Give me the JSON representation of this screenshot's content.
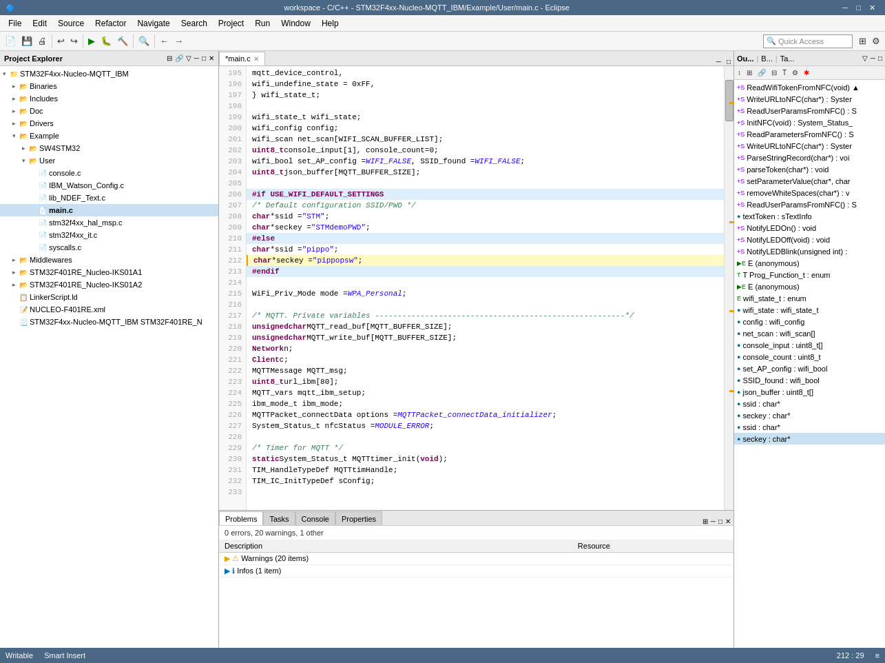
{
  "titleBar": {
    "title": "workspace - C/C++ - STM32F4xx-Nucleo-MQTT_IBM/Example/User/main.c - Eclipse",
    "icon": "🔷",
    "minimize": "─",
    "maximize": "□",
    "close": "✕"
  },
  "menuBar": {
    "items": [
      "File",
      "Edit",
      "Source",
      "Refactor",
      "Navigate",
      "Search",
      "Project",
      "Run",
      "Window",
      "Help"
    ]
  },
  "quickAccess": {
    "label": "Quick Access",
    "placeholder": "Quick Access"
  },
  "leftPanel": {
    "title": "Project Explorer",
    "closeIcon": "✕",
    "tree": [
      {
        "id": "root",
        "label": "STM32F4xx-Nucleo-MQTT_IBM",
        "indent": 0,
        "expanded": true,
        "type": "project"
      },
      {
        "id": "binaries",
        "label": "Binaries",
        "indent": 1,
        "expanded": false,
        "type": "folder"
      },
      {
        "id": "includes",
        "label": "Includes",
        "indent": 1,
        "expanded": false,
        "type": "folder"
      },
      {
        "id": "doc",
        "label": "Doc",
        "indent": 1,
        "expanded": false,
        "type": "folder"
      },
      {
        "id": "drivers",
        "label": "Drivers",
        "indent": 1,
        "expanded": false,
        "type": "folder"
      },
      {
        "id": "example",
        "label": "Example",
        "indent": 1,
        "expanded": true,
        "type": "folder"
      },
      {
        "id": "sw4stm32",
        "label": "SW4STM32",
        "indent": 2,
        "expanded": false,
        "type": "folder"
      },
      {
        "id": "user",
        "label": "User",
        "indent": 2,
        "expanded": true,
        "type": "folder"
      },
      {
        "id": "consolec",
        "label": "console.c",
        "indent": 3,
        "expanded": false,
        "type": "c-file"
      },
      {
        "id": "ibmconfig",
        "label": "IBM_Watson_Config.c",
        "indent": 3,
        "expanded": false,
        "type": "c-file"
      },
      {
        "id": "libndef",
        "label": "lib_NDEF_Text.c",
        "indent": 3,
        "expanded": false,
        "type": "c-file"
      },
      {
        "id": "mainc",
        "label": "main.c",
        "indent": 3,
        "expanded": false,
        "type": "c-file",
        "selected": true
      },
      {
        "id": "stm32hal",
        "label": "stm32f4xx_hal_msp.c",
        "indent": 3,
        "expanded": false,
        "type": "c-file"
      },
      {
        "id": "stm32f4",
        "label": "stm32f4xx_it.c",
        "indent": 3,
        "expanded": false,
        "type": "c-file"
      },
      {
        "id": "syscalls",
        "label": "syscalls.c",
        "indent": 3,
        "expanded": false,
        "type": "c-file"
      },
      {
        "id": "middlewares",
        "label": "Middlewares",
        "indent": 1,
        "expanded": false,
        "type": "folder"
      },
      {
        "id": "stm32f401re_iks01a1",
        "label": "STM32F401RE_Nucleo-IKS01A1",
        "indent": 1,
        "expanded": false,
        "type": "folder"
      },
      {
        "id": "stm32f401re_iks01a2",
        "label": "STM32F401RE_Nucleo-IKS01A2",
        "indent": 1,
        "expanded": false,
        "type": "folder"
      },
      {
        "id": "linkerscript",
        "label": "LinkerScript.ld",
        "indent": 1,
        "expanded": false,
        "type": "ld-file"
      },
      {
        "id": "nucleoxml",
        "label": "NUCLEO-F401RE.xml",
        "indent": 1,
        "expanded": false,
        "type": "xml-file"
      },
      {
        "id": "stm32desc",
        "label": "STM32F4xx-Nucleo-MQTT_IBM STM32F401RE_N",
        "indent": 1,
        "expanded": false,
        "type": "other-file"
      }
    ]
  },
  "editorTab": {
    "label": "*main.c",
    "closeIcon": "✕",
    "dirty": true
  },
  "codeLines": [
    {
      "num": 195,
      "content": "    mqtt_device_control,",
      "type": "normal"
    },
    {
      "num": 196,
      "content": "    wifi_undefine_state       = 0xFF,",
      "type": "normal"
    },
    {
      "num": 197,
      "content": "} wifi_state_t;",
      "type": "normal"
    },
    {
      "num": 198,
      "content": "",
      "type": "normal"
    },
    {
      "num": 199,
      "content": "wifi_state_t wifi_state;",
      "type": "normal"
    },
    {
      "num": 200,
      "content": "wifi_config config;",
      "type": "normal"
    },
    {
      "num": 201,
      "content": "wifi_scan net_scan[WIFI_SCAN_BUFFER_LIST];",
      "type": "normal"
    },
    {
      "num": 202,
      "content": "uint8_t console_input[1], console_count=0;",
      "type": "normal"
    },
    {
      "num": 203,
      "content": "wifi_bool set_AP_config = WIFI_FALSE, SSID_found = WIFI_FALSE;",
      "type": "normal"
    },
    {
      "num": 204,
      "content": "uint8_t json_buffer[MQTT_BUFFER_SIZE];",
      "type": "normal"
    },
    {
      "num": 205,
      "content": "",
      "type": "normal"
    },
    {
      "num": 206,
      "content": "#if USE_WIFI_DEFAULT_SETTINGS",
      "type": "preprocessor"
    },
    {
      "num": 207,
      "content": "    /* Default configuration SSID/PWD */",
      "type": "comment"
    },
    {
      "num": 208,
      "content": "    char *ssid = \"STM\";",
      "type": "normal"
    },
    {
      "num": 209,
      "content": "    char *seckey = \"STMdemoPWD\";",
      "type": "normal"
    },
    {
      "num": 210,
      "content": "#else",
      "type": "preprocessor"
    },
    {
      "num": 211,
      "content": "    char *ssid = \"pippo\";",
      "type": "normal"
    },
    {
      "num": 212,
      "content": "    char *seckey = \"pippopsw\";",
      "type": "current"
    },
    {
      "num": 213,
      "content": "#endif",
      "type": "preprocessor"
    },
    {
      "num": 214,
      "content": "",
      "type": "normal"
    },
    {
      "num": 215,
      "content": "    WiFi_Priv_Mode mode = WPA_Personal;",
      "type": "normal"
    },
    {
      "num": 216,
      "content": "",
      "type": "normal"
    },
    {
      "num": 217,
      "content": "/* MQTT. Private variables -------------------------------------------------------*/",
      "type": "comment"
    },
    {
      "num": 218,
      "content": "unsigned char MQTT_read_buf[MQTT_BUFFER_SIZE];",
      "type": "normal"
    },
    {
      "num": 219,
      "content": "unsigned char MQTT_write_buf[MQTT_BUFFER_SIZE];",
      "type": "normal"
    },
    {
      "num": 220,
      "content": "Network n;",
      "type": "normal"
    },
    {
      "num": 221,
      "content": "Client c;",
      "type": "normal"
    },
    {
      "num": 222,
      "content": "MQTTMessage  MQTT_msg;",
      "type": "normal"
    },
    {
      "num": 223,
      "content": "uint8_t url_ibm[80];",
      "type": "normal"
    },
    {
      "num": 224,
      "content": "MQTT_vars mqtt_ibm_setup;",
      "type": "normal"
    },
    {
      "num": 225,
      "content": "ibm_mode_t ibm_mode;",
      "type": "normal"
    },
    {
      "num": 226,
      "content": "MQTTPacket_connectData options = MQTTPacket_connectData_initializer;",
      "type": "normal"
    },
    {
      "num": 227,
      "content": "System_Status_t nfcStatus = MODULE_ERROR;",
      "type": "normal"
    },
    {
      "num": 228,
      "content": "",
      "type": "normal"
    },
    {
      "num": 229,
      "content": "/* Timer for MQTT */",
      "type": "comment"
    },
    {
      "num": 230,
      "content": "static System_Status_t MQTTtimer_init(void);",
      "type": "normal"
    },
    {
      "num": 231,
      "content": "TIM_HandleTypeDef        MQTTtimHandle;",
      "type": "normal"
    },
    {
      "num": 232,
      "content": "TIM_IC_InitTypeDef        sConfig;",
      "type": "normal"
    },
    {
      "num": 233,
      "content": "",
      "type": "normal"
    }
  ],
  "outlinePanel": {
    "tabs": [
      "Ou...",
      "B...",
      "Ta..."
    ],
    "items": [
      {
        "label": "ReadWifiTokenFromNFC(void) ▲",
        "type": "fn",
        "icon": "+S"
      },
      {
        "label": "WriteURLtoNFC(char*) : Syster",
        "type": "fn",
        "icon": "+S"
      },
      {
        "label": "ReadUserParamsFromNFC() : S",
        "type": "fn",
        "icon": "+S"
      },
      {
        "label": "InitNFC(void) : System_Status_",
        "type": "fn",
        "icon": "+"
      },
      {
        "label": "ReadParametersFromNFC() : S",
        "type": "fn",
        "icon": "+S"
      },
      {
        "label": "WriteURLtoNFC(char*) : Syster",
        "type": "fn",
        "icon": "+S"
      },
      {
        "label": "ParseStringRecord(char*) : voi",
        "type": "fn",
        "icon": "+S"
      },
      {
        "label": "parseToken(char*) : void",
        "type": "fn",
        "icon": "+S"
      },
      {
        "label": "setParameterValue(char*, char",
        "type": "fn",
        "icon": "+S"
      },
      {
        "label": "removeWhiteSpaces(char*) : v",
        "type": "fn",
        "icon": "+S"
      },
      {
        "label": "ReadUserParamsFromNFC() : S",
        "type": "fn",
        "icon": "+S"
      },
      {
        "label": "textToken : sTextInfo",
        "type": "var",
        "icon": "●"
      },
      {
        "label": "NotifyLEDOn() : void",
        "type": "fn",
        "icon": "+S"
      },
      {
        "label": "NotifyLEDOff(void) : void",
        "type": "fn",
        "icon": "+S"
      },
      {
        "label": "NotifyLEDBlink(unsigned int) :",
        "type": "fn",
        "icon": "+S"
      },
      {
        "label": "E (anonymous)",
        "type": "type",
        "icon": "▶E"
      },
      {
        "label": "T Prog_Function_t : enum",
        "type": "type",
        "icon": "T"
      },
      {
        "label": "E (anonymous)",
        "type": "type",
        "icon": "▶E"
      },
      {
        "label": "wifi_state_t : enum",
        "type": "type",
        "icon": "E"
      },
      {
        "label": "wifi_state : wifi_state_t",
        "type": "var",
        "icon": "●"
      },
      {
        "label": "config : wifi_config",
        "type": "var",
        "icon": "●"
      },
      {
        "label": "net_scan : wifi_scan[]",
        "type": "var",
        "icon": "●"
      },
      {
        "label": "console_input : uint8_t[]",
        "type": "var",
        "icon": "●"
      },
      {
        "label": "console_count : uint8_t",
        "type": "var",
        "icon": "●"
      },
      {
        "label": "set_AP_config : wifi_bool",
        "type": "var",
        "icon": "●"
      },
      {
        "label": "SSID_found : wifi_bool",
        "type": "var",
        "icon": "●"
      },
      {
        "label": "json_buffer : uint8_t[]",
        "type": "var",
        "icon": "●"
      },
      {
        "label": "ssid : char*",
        "type": "var",
        "icon": "●"
      },
      {
        "label": "seckey : char*",
        "type": "var",
        "icon": "●"
      },
      {
        "label": "ssid : char*",
        "type": "var",
        "icon": "●"
      },
      {
        "label": "seckey : char*",
        "type": "var",
        "icon": "●",
        "selected": true
      }
    ]
  },
  "bottomPanel": {
    "tabs": [
      "Problems",
      "Tasks",
      "Console",
      "Properties"
    ],
    "summary": "0 errors, 20 warnings, 1 other",
    "columns": [
      "Description",
      "Resource"
    ],
    "items": [
      {
        "type": "warning",
        "label": "Warnings (20 items)",
        "expandable": true
      },
      {
        "type": "info",
        "label": "Infos (1 item)",
        "expandable": true
      }
    ]
  },
  "statusBar": {
    "writable": "Writable",
    "insertMode": "Smart Insert",
    "position": "212 : 29",
    "moreIcon": "≡"
  }
}
